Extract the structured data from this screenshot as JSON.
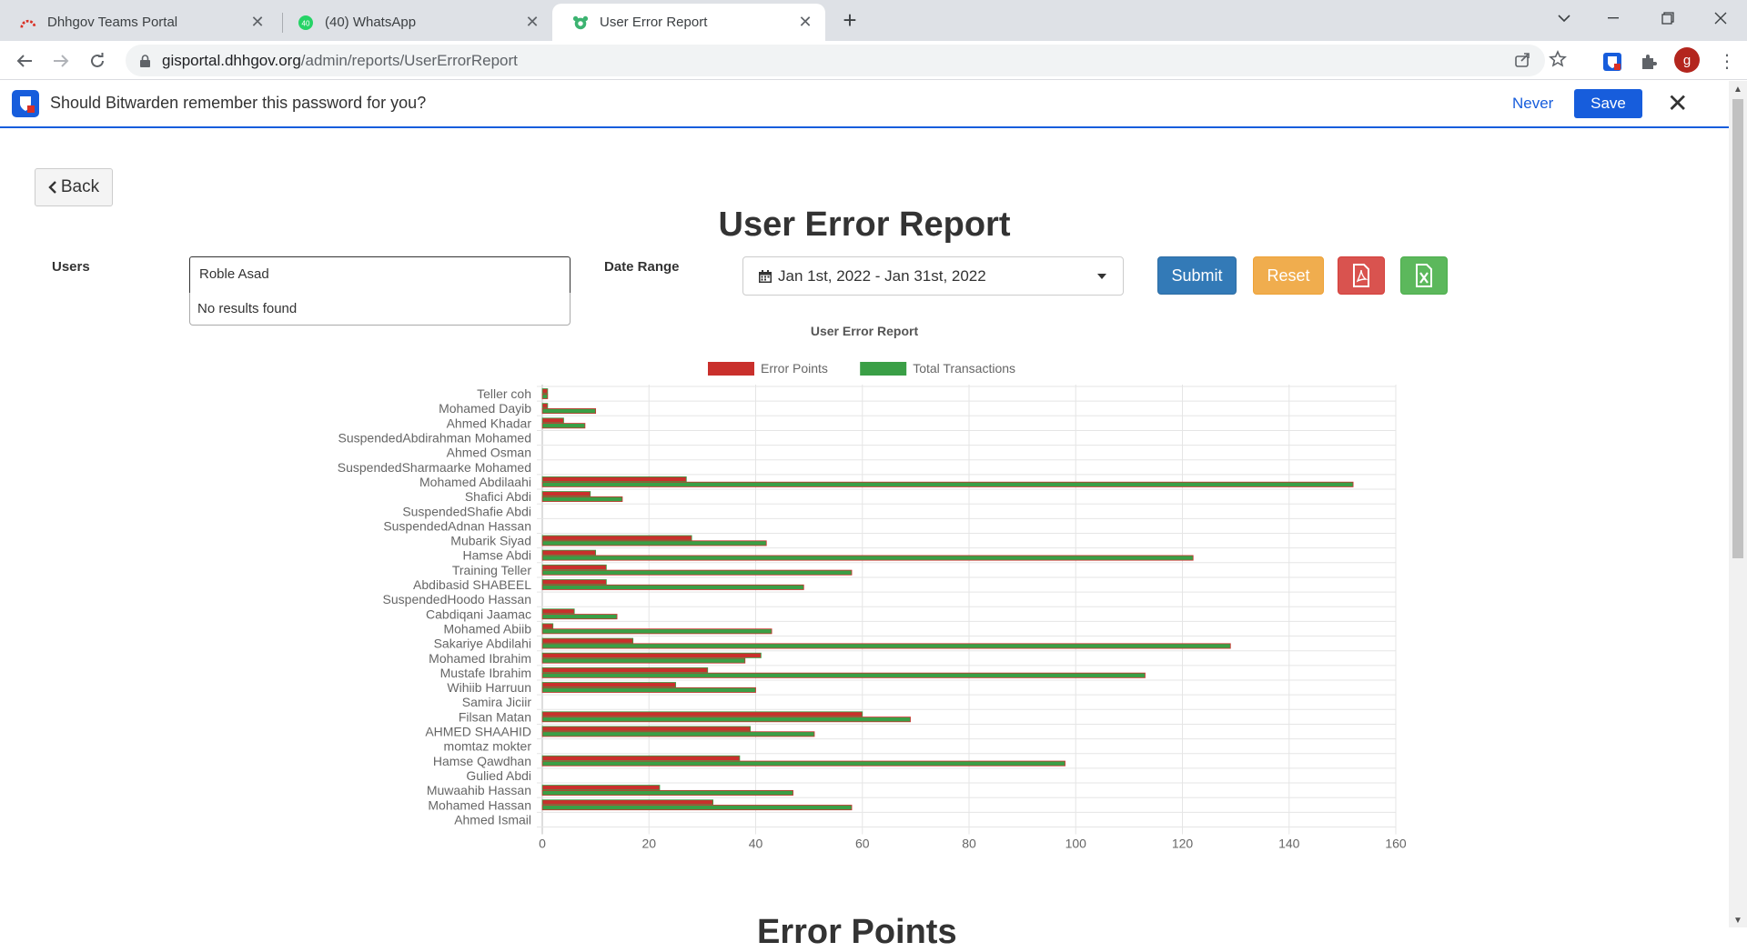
{
  "browser": {
    "tabs": [
      {
        "title": "Dhhgov Teams Portal",
        "active": false
      },
      {
        "title": "(40) WhatsApp",
        "active": false,
        "badge": "40"
      },
      {
        "title": "User Error Report",
        "active": true
      }
    ],
    "url_host": "gisportal.dhhgov.org",
    "url_path": "/admin/reports/UserErrorReport",
    "profile_initial": "g"
  },
  "bitwarden": {
    "message": "Should Bitwarden remember this password for you?",
    "never_label": "Never",
    "save_label": "Save"
  },
  "page": {
    "back_label": "Back",
    "title": "User Error Report",
    "users_label": "Users",
    "users_value": "Roble Asad",
    "users_dropdown_text": "No results found",
    "date_range_label": "Date Range",
    "date_range_value": "Jan 1st, 2022 - Jan 31st, 2022",
    "submit_label": "Submit",
    "reset_label": "Reset",
    "next_section_title": "Error Points"
  },
  "colors": {
    "error": "#c9302c",
    "total": "#3a9f46",
    "primary": "#337ab7",
    "warning": "#f0ad4e",
    "danger": "#d9534f",
    "success": "#5cb85c",
    "bitwarden": "#175ddc"
  },
  "chart_data": {
    "type": "bar",
    "orientation": "horizontal",
    "title": "User Error Report",
    "legend_position": "top",
    "xlim": [
      0,
      160
    ],
    "x_ticks": [
      0,
      20,
      40,
      60,
      80,
      100,
      120,
      140,
      160
    ],
    "grid": true,
    "categories": [
      "Teller coh",
      "Mohamed Dayib",
      "Ahmed Khadar",
      "SuspendedAbdirahman Mohamed",
      "Ahmed Osman",
      "SuspendedSharmaarke Mohamed",
      "Mohamed Abdilaahi",
      "Shafici Abdi",
      "SuspendedShafie Abdi",
      "SuspendedAdnan Hassan",
      "Mubarik Siyad",
      "Hamse Abdi",
      "Training Teller",
      "Abdibasid SHABEEL",
      "SuspendedHoodo Hassan",
      "Cabdiqani Jaamac",
      "Mohamed Abiib",
      "Sakariye Abdilahi",
      "Mohamed Ibrahim",
      "Mustafe Ibrahim",
      "Wihiib Harruun",
      "Samira Jiciir",
      "Filsan Matan",
      "AHMED SHAAHID",
      "momtaz mokter",
      "Hamse Qawdhan",
      "Gulied Abdi",
      "Muwaahib Hassan",
      "Mohamed Hassan",
      "Ahmed Ismail"
    ],
    "series": [
      {
        "name": "Error Points",
        "values": [
          1,
          1,
          4,
          0,
          0,
          0,
          27,
          9,
          0,
          0,
          28,
          10,
          12,
          12,
          0,
          6,
          2,
          17,
          41,
          31,
          25,
          0,
          60,
          39,
          0,
          37,
          0,
          22,
          32,
          0
        ]
      },
      {
        "name": "Total Transactions",
        "values": [
          1,
          10,
          8,
          0,
          0,
          0,
          152,
          15,
          0,
          0,
          42,
          122,
          58,
          49,
          0,
          14,
          43,
          129,
          38,
          113,
          40,
          0,
          69,
          51,
          0,
          98,
          0,
          47,
          58,
          0
        ]
      }
    ]
  }
}
